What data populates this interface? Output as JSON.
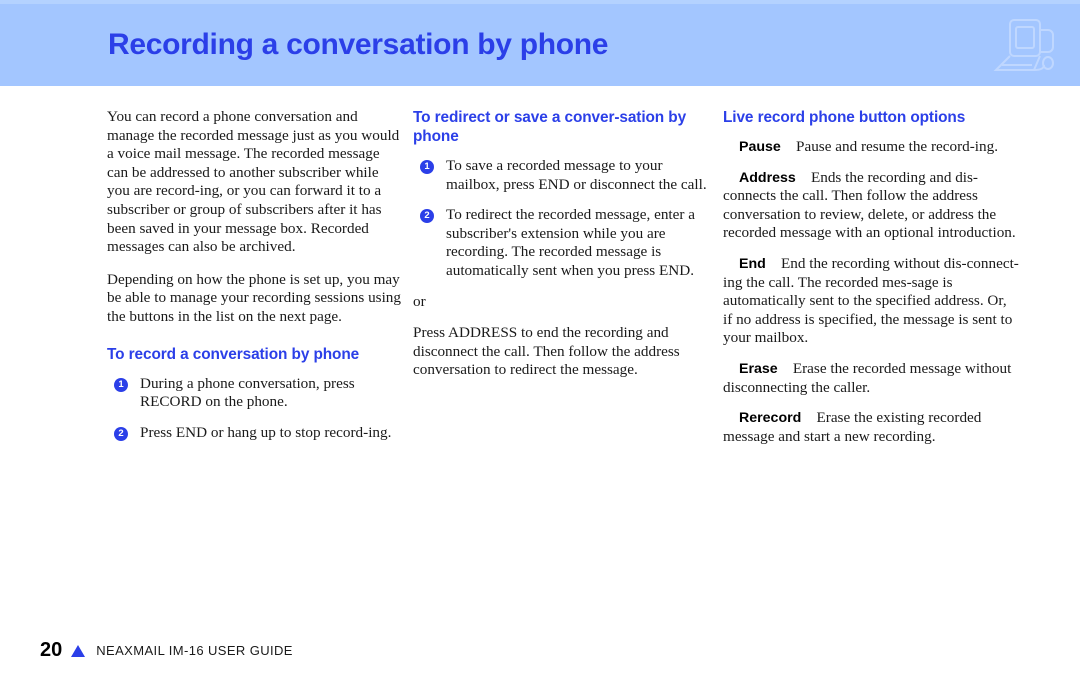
{
  "header": {
    "title": "Recording a conversation by phone",
    "band_color": "#a3c6ff",
    "title_color": "#2b3fe8",
    "watermark_icon": "computer-monitor-icon"
  },
  "columns": {
    "left": {
      "paragraphs": [
        "You can record a phone conversation and manage the recorded message just as you would a voice mail message. The recorded message can be addressed to another subscriber while you are record-ing, or you can forward it to a subscriber or group of subscribers after it has been saved in your message box. Recorded messages can also be archived.",
        "Depending on how the phone is set up, you may be able to manage your recording sessions using the buttons in the list on the next page."
      ],
      "heading": "To record a conversation by phone",
      "steps": [
        {
          "num": "1",
          "text": "During a phone conversation, press RECORD on the phone."
        },
        {
          "num": "2",
          "text": "Press END or hang up to stop record-ing."
        }
      ]
    },
    "middle": {
      "heading": "To redirect or save a conver-sation by phone",
      "steps": [
        {
          "num": "1",
          "text": "To save a recorded message to your mailbox, press END or disconnect the call."
        },
        {
          "num": "2",
          "text": "To redirect the recorded message, enter a subscriber's extension while you are recording. The recorded message is automatically sent when you press END."
        }
      ],
      "or_label": "or",
      "closing_paragraph": "Press ADDRESS to end the recording and disconnect the call. Then follow the address conversation to redirect the message."
    },
    "right": {
      "heading": "Live record phone button options",
      "options": [
        {
          "term": "Pause",
          "description": "Pause and resume the record-ing."
        },
        {
          "term": "Address",
          "description": "Ends the recording and dis-connects the call. Then follow the address conversation to review, delete, or address the recorded message with an optional introduction."
        },
        {
          "term": "End",
          "description": "End the recording without dis-connect-ing the call. The recorded mes-sage is automatically sent to the specified address. Or, if no address is specified, the message is sent to your mailbox."
        },
        {
          "term": "Erase",
          "description": "Erase the recorded message without disconnecting the caller."
        },
        {
          "term": "Rerecord",
          "description": "Erase the existing recorded message and start a new recording."
        }
      ]
    }
  },
  "footer": {
    "page_number": "20",
    "guide_title": "NEAXMAIL IM-16 USER GUIDE",
    "triangle_color": "#2b3fe8"
  }
}
